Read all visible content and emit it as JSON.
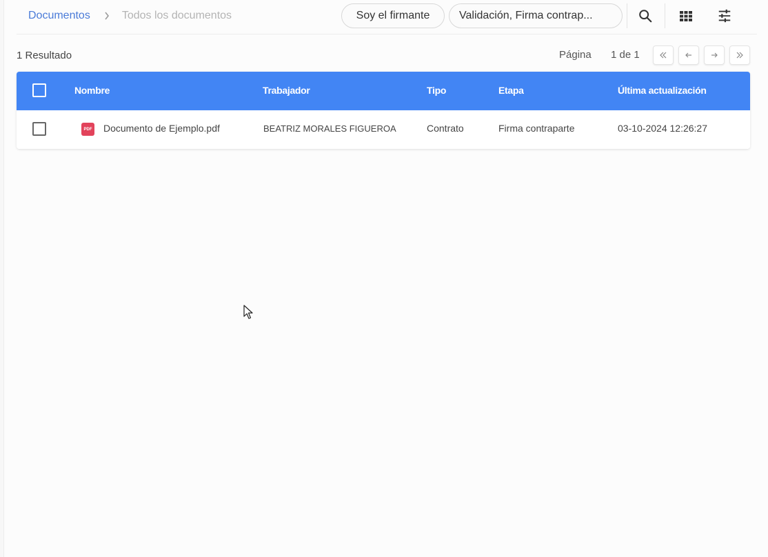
{
  "breadcrumb": {
    "root": "Documentos",
    "current": "Todos los documentos"
  },
  "filters": {
    "chip_signer": "Soy el firmante",
    "chip_stage": "Validación, Firma contrap..."
  },
  "toolbar": {
    "search_icon": "search-icon",
    "grid_icon": "grid-view-icon",
    "tune_icon": "tune-icon"
  },
  "results": {
    "count_label": "1 Resultado"
  },
  "pagination": {
    "label": "Página",
    "info": "1 de 1"
  },
  "table": {
    "columns": [
      "Nombre",
      "Trabajador",
      "Tipo",
      "Etapa",
      "Última actualización"
    ],
    "rows": [
      {
        "file_badge": "PDF",
        "name": "Documento de Ejemplo.pdf",
        "worker": "BEATRIZ MORALES FIGUEROA",
        "type": "Contrato",
        "stage": "Firma contraparte",
        "updated": "03-10-2024 12:26:27"
      }
    ]
  },
  "colors": {
    "header_bg": "#4285f4",
    "link": "#4a7bd8",
    "pdf_badge": "#e2435b"
  }
}
